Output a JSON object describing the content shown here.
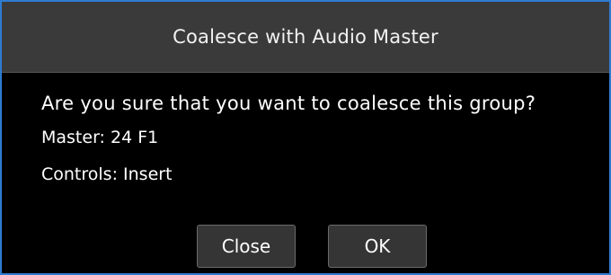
{
  "dialog": {
    "title": "Coalesce with Audio Master",
    "question": "Are you sure that you want to coalesce this group?",
    "master_line": "Master: 24 F1",
    "controls_line": "Controls: Insert"
  },
  "buttons": {
    "close_label": "Close",
    "ok_label": "OK"
  },
  "colors": {
    "background": "#000000",
    "titlebar": "#3a3a3a",
    "border_accent": "#2e7bd0",
    "button": "#353535"
  }
}
